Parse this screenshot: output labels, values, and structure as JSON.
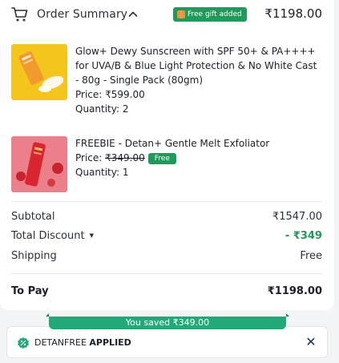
{
  "header": {
    "title": "Order Summary",
    "gift_badge": "Free gift added",
    "total": "₹1198.00"
  },
  "items": [
    {
      "name": "Glow+ Dewy Sunscreen with SPF 50+ & PA++++ for UVA/B & Blue Light Protection & No White Cast - 80g - Single Pack (80gm)",
      "price_label": "Price: ",
      "price": "₹599.00",
      "qty_label": "Quantity: ",
      "qty": "2"
    },
    {
      "name": "FREEBIE - Detan+ Gentle Melt Exfoliator",
      "price_label": "Price: ",
      "price": "₹349.00",
      "free_label": "Free",
      "qty_label": "Quantity: ",
      "qty": "1"
    }
  ],
  "summary": {
    "subtotal_label": "Subtotal",
    "subtotal_value": "₹1547.00",
    "discount_label": "Total Discount",
    "discount_value": "- ₹349",
    "shipping_label": "Shipping",
    "shipping_value": "Free",
    "topay_label": "To Pay",
    "topay_value": "₹1198.00"
  },
  "savings": {
    "text": "You saved ₹349.00"
  },
  "coupon": {
    "code": "DETANFREE",
    "status": "APPLIED"
  },
  "colors": {
    "accent_green": "#1f9a5a",
    "banner_green": "#23a878",
    "close_navy": "#1c2c5a"
  }
}
